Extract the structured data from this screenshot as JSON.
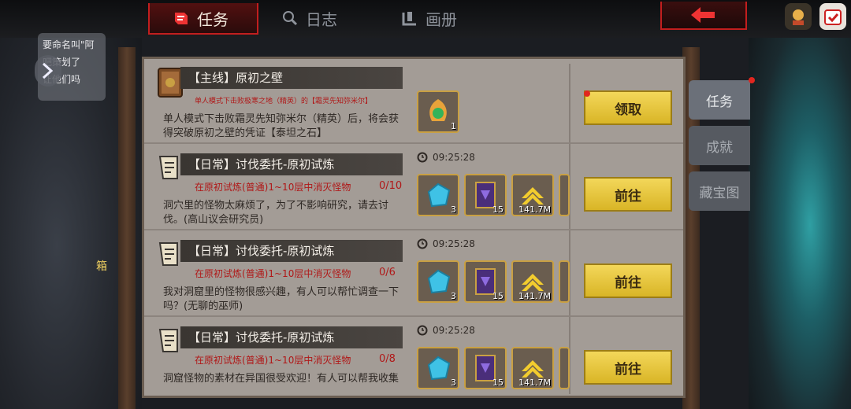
{
  "tabs": [
    {
      "label": "任务",
      "active": true
    },
    {
      "label": "日志",
      "active": false
    },
    {
      "label": "画册",
      "active": false
    }
  ],
  "chat": {
    "lines": [
      "要命名叫\"阿",
      "吧策划了",
      "让他们吗"
    ]
  },
  "side_hint": "箱",
  "side_tabs": [
    {
      "label": "任务",
      "active": true
    },
    {
      "label": "成就",
      "active": false
    },
    {
      "label": "藏宝图",
      "active": false
    }
  ],
  "quests": [
    {
      "title": "【主线】原初之壁",
      "subtitle": "单人模式下击败极寒之地（精英）的【霜灵先知弥米尔】",
      "progress": "",
      "description": "单人模式下击败霜灵先知弥米尔（精英）后，将会获得突破原初之壁的凭证【泰坦之石】",
      "timer": "",
      "rewards": [
        {
          "icon": "titan-stone-icon",
          "count": "1"
        }
      ],
      "button": "领取"
    },
    {
      "title": "【日常】讨伐委托-原初试炼",
      "subtitle": "在原初试炼(普通)1~10层中消灭怪物",
      "progress": "0/10",
      "description": "洞穴里的怪物太麻烦了，为了不影响研究，请去讨伐。(高山议会研究员)",
      "timer": "09:25:28",
      "rewards": [
        {
          "icon": "blue-crystal-icon",
          "count": "3"
        },
        {
          "icon": "purple-book-icon",
          "count": "15"
        },
        {
          "icon": "gold-rank-icon",
          "count": "141.7M"
        }
      ],
      "button": "前往"
    },
    {
      "title": "【日常】讨伐委托-原初试炼",
      "subtitle": "在原初试炼(普通)1~10层中消灭怪物",
      "progress": "0/6",
      "description": "我对洞窟里的怪物很感兴趣，有人可以帮忙调查一下吗？(无聊的巫师)",
      "timer": "09:25:28",
      "rewards": [
        {
          "icon": "blue-crystal-icon",
          "count": "3"
        },
        {
          "icon": "purple-book-icon",
          "count": "15"
        },
        {
          "icon": "gold-rank-icon",
          "count": "141.7M"
        }
      ],
      "button": "前往"
    },
    {
      "title": "【日常】讨伐委托-原初试炼",
      "subtitle": "在原初试炼(普通)1~10层中消灭怪物",
      "progress": "0/8",
      "description": "洞窟怪物的素材在异国很受欢迎！有人可以帮我收集",
      "timer": "09:25:28",
      "rewards": [
        {
          "icon": "blue-crystal-icon",
          "count": "3"
        },
        {
          "icon": "purple-book-icon",
          "count": "15"
        },
        {
          "icon": "gold-rank-icon",
          "count": "141.7M"
        }
      ],
      "button": "前往"
    }
  ],
  "colors": {
    "accent_red": "#c21e1e",
    "gold_button": "#e8c63c",
    "panel_bg": "#a39c96",
    "progress_red": "#b01818"
  }
}
